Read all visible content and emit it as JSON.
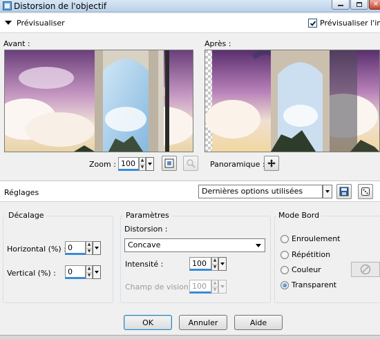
{
  "window": {
    "title": "Distorsion de l'objectif"
  },
  "preview": {
    "label": "Prévisualiser",
    "checkbox_label": "Prévisualiser l'image",
    "checked": true,
    "before_label": "Avant :",
    "after_label": "Après :"
  },
  "zoom": {
    "label": "Zoom :",
    "value": "100",
    "pan_label": "Panoramique :"
  },
  "settings": {
    "label": "Réglages",
    "preset_value": "Dernières options utilisées"
  },
  "offset": {
    "title": "Décalage",
    "horizontal_label": "Horizontal (%) :",
    "horizontal_value": "0",
    "vertical_label": "Vertical (%) :",
    "vertical_value": "0"
  },
  "params": {
    "title": "Paramètres",
    "distortion_label": "Distorsion :",
    "distortion_value": "Concave",
    "intensity_label": "Intensité :",
    "intensity_value": "100",
    "fov_label": "Champ de vision :",
    "fov_value": "100"
  },
  "edge_mode": {
    "title": "Mode Bord",
    "options": [
      "Enroulement",
      "Répétition",
      "Couleur",
      "Transparent"
    ],
    "selected": "Transparent"
  },
  "buttons": {
    "ok": "OK",
    "cancel": "Annuler",
    "help": "Aide"
  },
  "colors": {
    "accent_blue": "#3a8ad8",
    "title_bar": "#c9dcef"
  }
}
